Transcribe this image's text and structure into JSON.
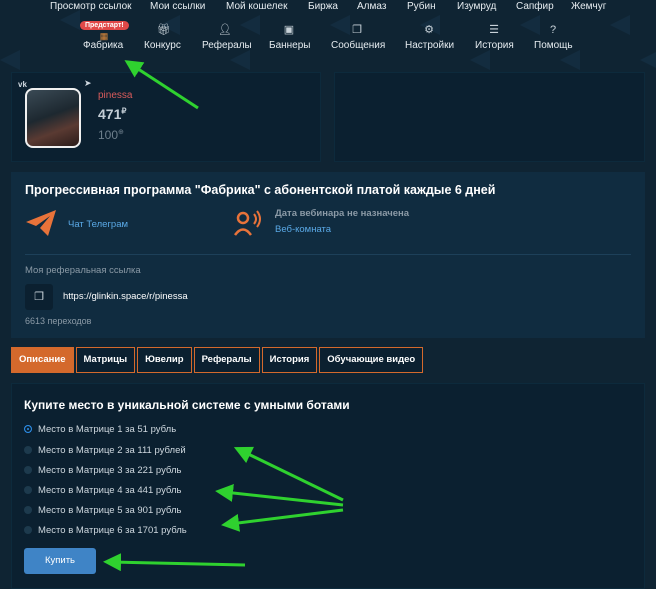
{
  "top_menu": [
    "Просмотр ссылок",
    "Мои ссылки",
    "Мой кошелек",
    "Биржа",
    "Алмаз",
    "Рубин",
    "Изумруд",
    "Сапфир",
    "Жемчуг"
  ],
  "sub_menu": [
    {
      "label": "Фабрика",
      "icon": "factory-icon"
    },
    {
      "label": "Конкурс",
      "icon": "gift-icon"
    },
    {
      "label": "Рефералы",
      "icon": "add-user-icon"
    },
    {
      "label": "Баннеры",
      "icon": "image-icon"
    },
    {
      "label": "Сообщения",
      "icon": "messages-icon"
    },
    {
      "label": "Настройки",
      "icon": "gear-icon"
    },
    {
      "label": "История",
      "icon": "list-icon"
    },
    {
      "label": "Помощь",
      "icon": "help-icon"
    }
  ],
  "badge": "Предстарт!",
  "profile": {
    "vk": "vk",
    "username": "pinessa",
    "balance": "471",
    "currency": "₽",
    "points": "100"
  },
  "program": {
    "title": "Прогрессивная программа \"Фабрика\" с абонентской платой каждые 6 дней",
    "telegram_link": "Чат Телеграм",
    "webinar_text": "Дата вебинара не назначена",
    "webroom_link": "Веб-комната",
    "ref_label": "Моя реферальная ссылка",
    "ref_url": "https://glinkin.space/r/pinessa",
    "transitions": "6613 переходов"
  },
  "tabs": [
    "Описание",
    "Матрицы",
    "Ювелир",
    "Рефералы",
    "История",
    "Обучающие видео"
  ],
  "buy": {
    "heading": "Купите место в уникальной системе с умными ботами",
    "options": [
      "Место в Матрице 1 за 51 рубль",
      "Место в Матрице 2 за 111 рублей",
      "Место в Матрице 3 за 221 рубль",
      "Место в Матрице 4 за 441 рубль",
      "Место в Матрице 5 за 901 рубль",
      "Место в Матрице 6 за 1701 рубль"
    ],
    "selected": 0,
    "button": "Купить"
  },
  "colors": {
    "accent": "#d4692c",
    "link": "#5aa9e6",
    "button": "#3f84c6",
    "arrow": "#2fd12f"
  }
}
